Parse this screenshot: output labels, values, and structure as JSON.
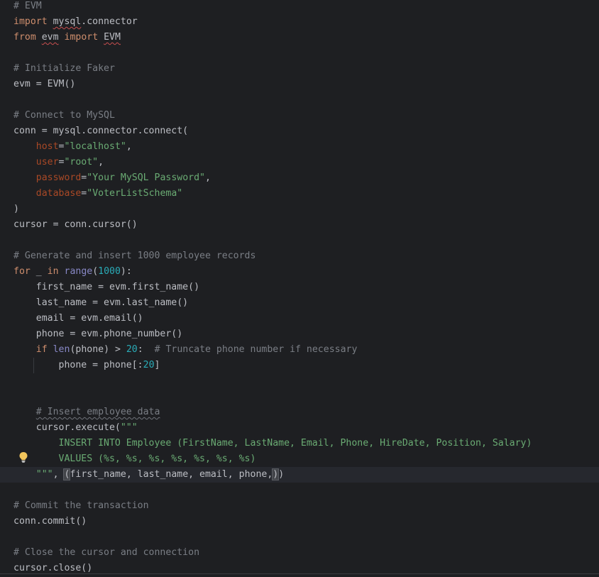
{
  "editor": {
    "language": "python",
    "lines": [
      {
        "id": "l1",
        "segments": [
          {
            "t": "# EVM",
            "c": "c"
          }
        ]
      },
      {
        "id": "l2",
        "segments": [
          {
            "t": "import",
            "c": "k"
          },
          {
            "t": " "
          },
          {
            "t": "mysql",
            "c": "sq"
          },
          {
            "t": ".connector"
          }
        ]
      },
      {
        "id": "l3",
        "segments": [
          {
            "t": "from",
            "c": "k"
          },
          {
            "t": " "
          },
          {
            "t": "evm",
            "c": "sq"
          },
          {
            "t": " "
          },
          {
            "t": "import",
            "c": "k"
          },
          {
            "t": " "
          },
          {
            "t": "EVM",
            "c": "sq"
          }
        ]
      },
      {
        "id": "l4",
        "segments": []
      },
      {
        "id": "l5",
        "segments": [
          {
            "t": "# Initialize Faker",
            "c": "c"
          }
        ]
      },
      {
        "id": "l6",
        "segments": [
          {
            "t": "evm = EVM()"
          }
        ]
      },
      {
        "id": "l7",
        "segments": []
      },
      {
        "id": "l8",
        "segments": [
          {
            "t": "# Connect to MySQL",
            "c": "c"
          }
        ]
      },
      {
        "id": "l9",
        "segments": [
          {
            "t": "conn = mysql.connector.connect("
          }
        ]
      },
      {
        "id": "l10",
        "segments": [
          {
            "t": "    "
          },
          {
            "t": "host",
            "c": "p"
          },
          {
            "t": "="
          },
          {
            "t": "\"localhost\"",
            "c": "s"
          },
          {
            "t": ","
          }
        ]
      },
      {
        "id": "l11",
        "segments": [
          {
            "t": "    "
          },
          {
            "t": "user",
            "c": "p"
          },
          {
            "t": "="
          },
          {
            "t": "\"root\"",
            "c": "s"
          },
          {
            "t": ","
          }
        ]
      },
      {
        "id": "l12",
        "segments": [
          {
            "t": "    "
          },
          {
            "t": "password",
            "c": "p"
          },
          {
            "t": "="
          },
          {
            "t": "\"Your MySQL Password\"",
            "c": "s"
          },
          {
            "t": ","
          }
        ]
      },
      {
        "id": "l13",
        "segments": [
          {
            "t": "    "
          },
          {
            "t": "database",
            "c": "p"
          },
          {
            "t": "="
          },
          {
            "t": "\"VoterListSchema\"",
            "c": "s"
          }
        ]
      },
      {
        "id": "l14",
        "segments": [
          {
            "t": ")"
          }
        ]
      },
      {
        "id": "l15",
        "segments": [
          {
            "t": "cursor = conn.cursor()"
          }
        ]
      },
      {
        "id": "l16",
        "segments": []
      },
      {
        "id": "l17",
        "segments": [
          {
            "t": "# Generate and insert 1000 employee records",
            "c": "c"
          }
        ]
      },
      {
        "id": "l18",
        "segments": [
          {
            "t": "for",
            "c": "k"
          },
          {
            "t": " _ "
          },
          {
            "t": "in",
            "c": "k"
          },
          {
            "t": " "
          },
          {
            "t": "range",
            "c": "b"
          },
          {
            "t": "("
          },
          {
            "t": "1000",
            "c": "n"
          },
          {
            "t": "):"
          }
        ]
      },
      {
        "id": "l19",
        "segments": [
          {
            "t": "    first_name = evm.first_name()"
          }
        ]
      },
      {
        "id": "l20",
        "segments": [
          {
            "t": "    last_name = evm.last_name()"
          }
        ]
      },
      {
        "id": "l21",
        "segments": [
          {
            "t": "    email = evm.email()"
          }
        ]
      },
      {
        "id": "l22",
        "segments": [
          {
            "t": "    phone = evm.phone_number()"
          }
        ]
      },
      {
        "id": "l23",
        "segments": [
          {
            "t": "    "
          },
          {
            "t": "if",
            "c": "k"
          },
          {
            "t": " "
          },
          {
            "t": "len",
            "c": "b"
          },
          {
            "t": "(phone) > "
          },
          {
            "t": "20",
            "c": "n"
          },
          {
            "t": ":  "
          },
          {
            "t": "# Truncate phone number if necessary",
            "c": "c"
          }
        ]
      },
      {
        "id": "l24",
        "segments": [
          {
            "t": "        phone = phone[:"
          },
          {
            "t": "20",
            "c": "n"
          },
          {
            "t": "]"
          }
        ]
      },
      {
        "id": "l25",
        "segments": []
      },
      {
        "id": "l26",
        "segments": []
      },
      {
        "id": "l27",
        "segments": [
          {
            "t": "    "
          },
          {
            "t": "# Insert employee data",
            "c": "c sqc"
          }
        ]
      },
      {
        "id": "l28",
        "segments": [
          {
            "t": "    cursor.execute("
          },
          {
            "t": "\"\"\"",
            "c": "s"
          }
        ]
      },
      {
        "id": "l29",
        "segments": [
          {
            "t": "        INSERT INTO Employee (FirstName, LastName, Email, Phone, HireDate, Position, Salary)",
            "c": "s"
          }
        ]
      },
      {
        "id": "l30",
        "segments": [
          {
            "t": "        VALUES (%s, %s, %s, %s, %s, %s, %s)",
            "c": "s"
          }
        ]
      },
      {
        "id": "l31",
        "current": true,
        "segments": [
          {
            "t": "    "
          },
          {
            "t": "\"\"\"",
            "c": "s"
          },
          {
            "t": ", "
          },
          {
            "t": "(",
            "c": "bm"
          },
          {
            "t": "first_name, last_name, email, phone,"
          },
          {
            "t": ")",
            "c": "bm"
          },
          {
            "t": ")"
          }
        ]
      },
      {
        "id": "l32",
        "segments": []
      },
      {
        "id": "l33",
        "segments": [
          {
            "t": "# Commit the transaction",
            "c": "c"
          }
        ]
      },
      {
        "id": "l34",
        "segments": [
          {
            "t": "conn.commit()"
          }
        ]
      },
      {
        "id": "l35",
        "segments": []
      },
      {
        "id": "l36",
        "segments": [
          {
            "t": "# Close the cursor and connection",
            "c": "c"
          }
        ]
      },
      {
        "id": "l37",
        "segments": [
          {
            "t": "cursor.close()"
          }
        ]
      }
    ]
  },
  "icons": {
    "intention_bulb": "lightbulb-icon",
    "bulb_color": "#f2c55c"
  },
  "colors": {
    "background": "#1e1f22",
    "current_line": "#26282e",
    "comment": "#7a7e85",
    "keyword": "#cf8e6d",
    "string": "#6aab73",
    "number": "#2aacb8",
    "parameter": "#aa4926"
  }
}
